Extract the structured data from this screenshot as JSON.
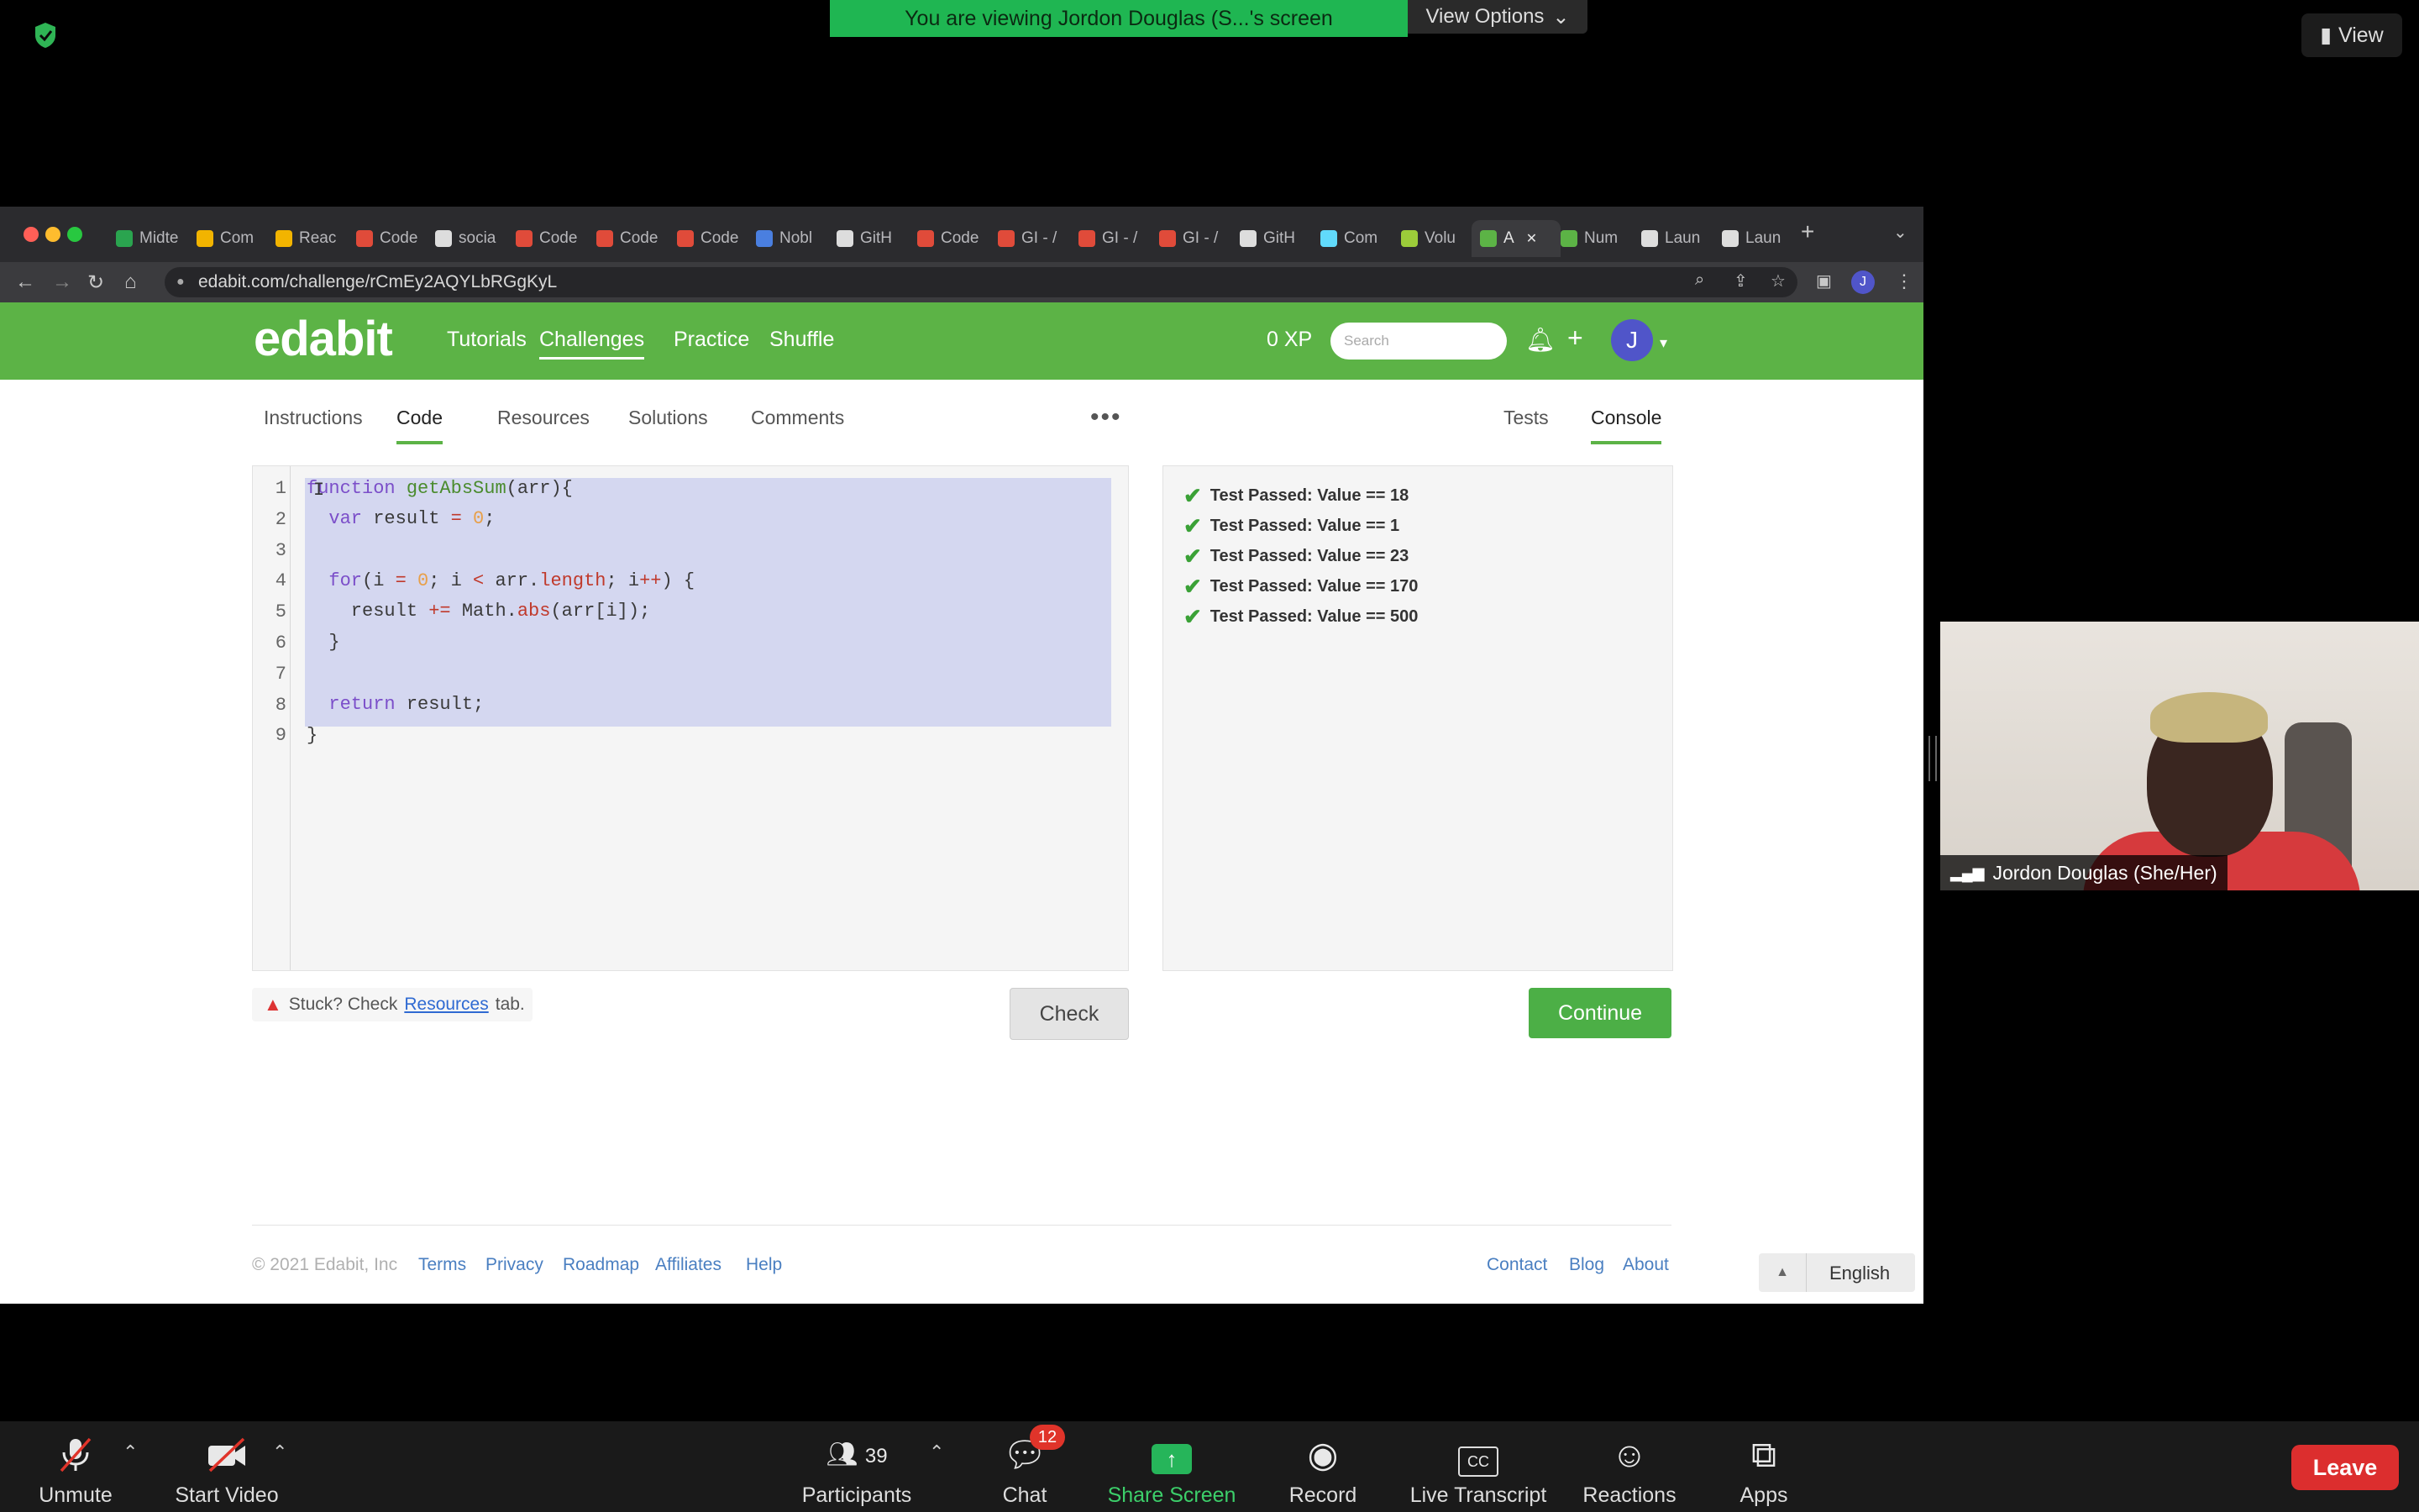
{
  "zoom": {
    "share_banner": "You are viewing Jordon Douglas (S...'s screen",
    "view_options": "View Options",
    "view_button": "View",
    "participant_name": "Jordon Douglas (She/Her)",
    "bottom": {
      "unmute": "Unmute",
      "start_video": "Start Video",
      "participants": "Participants",
      "participants_count": "39",
      "chat": "Chat",
      "chat_badge": "12",
      "share_screen": "Share Screen",
      "record": "Record",
      "live_transcript": "Live Transcript",
      "reactions": "Reactions",
      "apps": "Apps",
      "leave": "Leave"
    }
  },
  "browser": {
    "url": "edabit.com/challenge/rCmEy2AQYLbRGgKyL",
    "tabs": [
      {
        "label": "Midte",
        "color": "#2aa44f"
      },
      {
        "label": "Com",
        "color": "#f2b400"
      },
      {
        "label": "Reac",
        "color": "#f2b400"
      },
      {
        "label": "Code",
        "color": "#e04b3a"
      },
      {
        "label": "socia",
        "color": "#dddddd"
      },
      {
        "label": "Code",
        "color": "#e04b3a"
      },
      {
        "label": "Code",
        "color": "#e04b3a"
      },
      {
        "label": "Code",
        "color": "#e04b3a"
      },
      {
        "label": "Nobl",
        "color": "#4a7fe0"
      },
      {
        "label": "GitH",
        "color": "#dddddd"
      },
      {
        "label": "Code",
        "color": "#e04b3a"
      },
      {
        "label": "GI - /",
        "color": "#e04b3a"
      },
      {
        "label": "GI - /",
        "color": "#e04b3a"
      },
      {
        "label": "GI - /",
        "color": "#e04b3a"
      },
      {
        "label": "GitH",
        "color": "#dddddd"
      },
      {
        "label": "Com",
        "color": "#61dafb"
      },
      {
        "label": "Volu",
        "color": "#9ccc3a"
      },
      {
        "label": "A",
        "color": "#5cb346"
      },
      {
        "label": "Num",
        "color": "#5cb346"
      },
      {
        "label": "Laun",
        "color": "#dddddd"
      },
      {
        "label": "Laun",
        "color": "#dddddd"
      }
    ],
    "avatar_letter": "J"
  },
  "site": {
    "logo": "edabit",
    "nav": [
      "Tutorials",
      "Challenges",
      "Practice",
      "Shuffle"
    ],
    "xp": "0 XP",
    "search_placeholder": "Search",
    "avatar_letter": "J",
    "left_tabs": [
      "Instructions",
      "Code",
      "Resources",
      "Solutions",
      "Comments"
    ],
    "right_tabs": [
      "Tests",
      "Console"
    ],
    "code_lines": [
      "1",
      "2",
      "3",
      "4",
      "5",
      "6",
      "7",
      "8",
      "9"
    ],
    "tests": [
      "Test Passed: Value == 18",
      "Test Passed: Value == 1",
      "Test Passed: Value == 23",
      "Test Passed: Value == 170",
      "Test Passed: Value == 500"
    ],
    "stuck_prefix": "Stuck? Check",
    "stuck_link": "Resources",
    "stuck_suffix": "tab.",
    "check": "Check",
    "continue": "Continue",
    "footer_left": [
      "© 2021 Edabit, Inc",
      "Terms",
      "Privacy",
      "Roadmap",
      "Affiliates",
      "Help"
    ],
    "footer_right": [
      "Contact",
      "Blog",
      "About"
    ],
    "language": "English"
  }
}
